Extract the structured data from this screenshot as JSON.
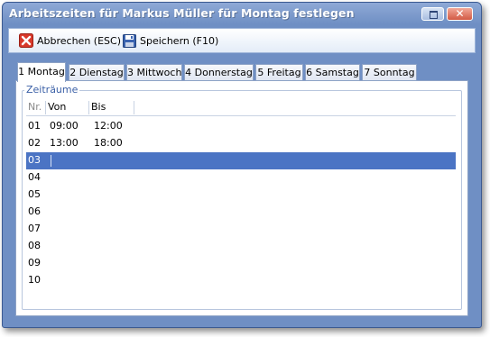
{
  "window": {
    "title": "Arbeitszeiten für Markus Müller für Montag festlegen"
  },
  "toolbar": {
    "cancel_label": "Abbrechen (ESC)",
    "save_label": "Speichern (F10)"
  },
  "tabs": [
    {
      "label": "1 Montag",
      "active": true
    },
    {
      "label": "2 Dienstag",
      "active": false
    },
    {
      "label": "3 Mittwoch",
      "active": false
    },
    {
      "label": "4 Donnerstag",
      "active": false
    },
    {
      "label": "5 Freitag",
      "active": false
    },
    {
      "label": "6 Samstag",
      "active": false
    },
    {
      "label": "7 Sonntag",
      "active": false
    }
  ],
  "group": {
    "title": "Zeiträume"
  },
  "grid": {
    "columns": {
      "nr": "Nr.",
      "von": "Von",
      "bis": "Bis"
    },
    "rows": [
      {
        "nr": "01",
        "von": "09:00",
        "bis": "12:00"
      },
      {
        "nr": "02",
        "von": "13:00",
        "bis": "18:00"
      },
      {
        "nr": "03",
        "von": "",
        "bis": ""
      },
      {
        "nr": "04",
        "von": "",
        "bis": ""
      },
      {
        "nr": "05",
        "von": "",
        "bis": ""
      },
      {
        "nr": "06",
        "von": "",
        "bis": ""
      },
      {
        "nr": "07",
        "von": "",
        "bis": ""
      },
      {
        "nr": "08",
        "von": "",
        "bis": ""
      },
      {
        "nr": "09",
        "von": "",
        "bis": ""
      },
      {
        "nr": "10",
        "von": "",
        "bis": ""
      }
    ],
    "selected_row": 2
  },
  "colors": {
    "titlebar": "#6f8fc4",
    "selection": "#4b74c4",
    "group_title": "#3a5fa6"
  },
  "icons": {
    "cancel": "red-x-icon",
    "save": "floppy-disk-icon",
    "restore": "restore-window-icon",
    "close": "close-icon"
  }
}
